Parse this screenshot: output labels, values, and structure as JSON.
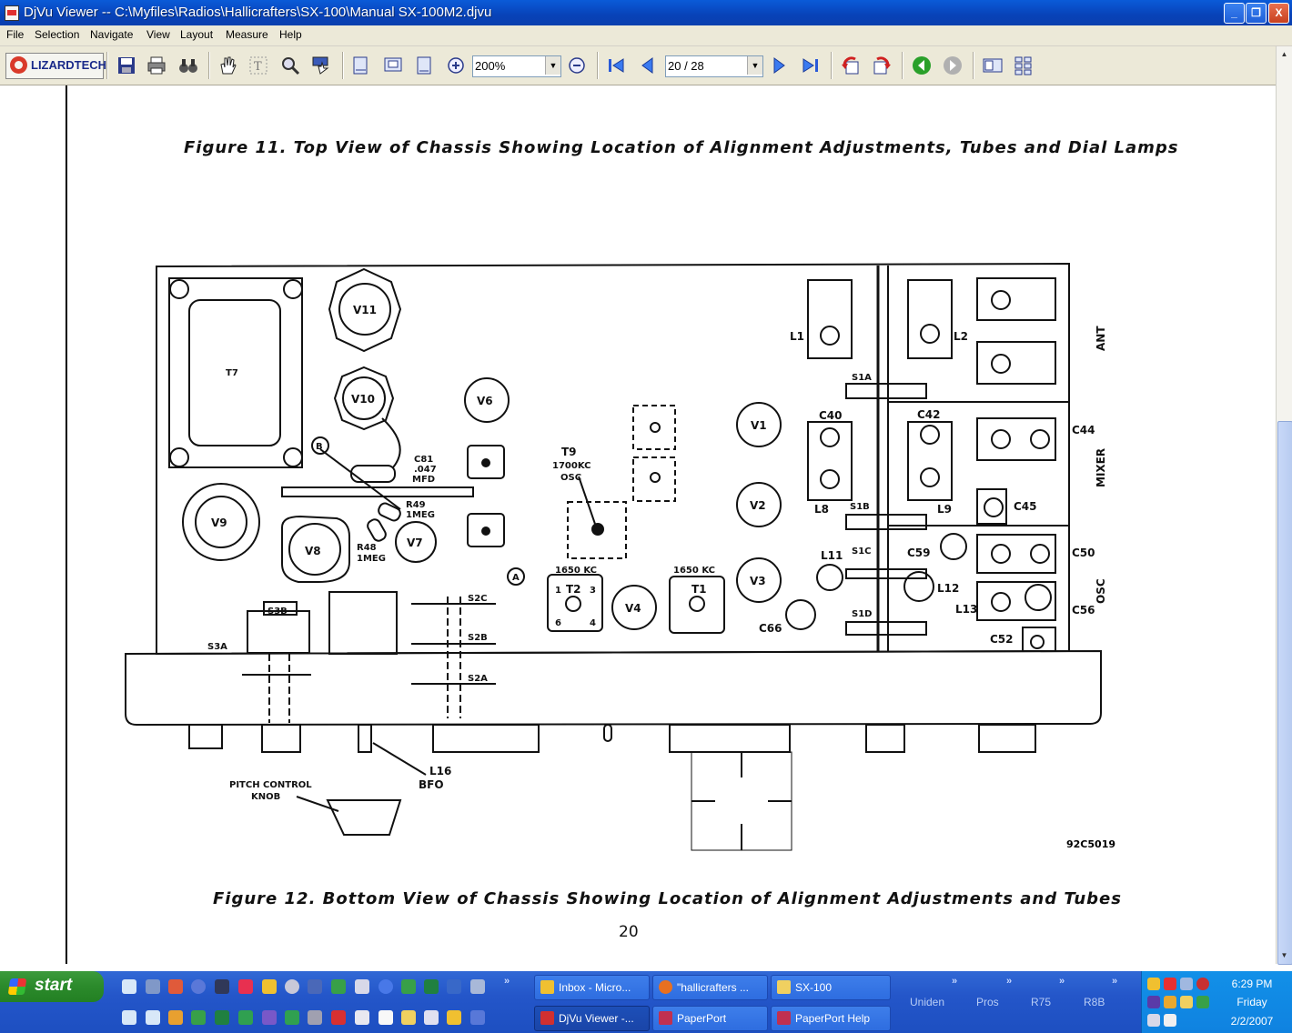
{
  "window": {
    "title": "DjVu Viewer -- C:\\Myfiles\\Radios\\Hallicrafters\\SX-100\\Manual SX-100M2.djvu",
    "minimize": "_",
    "maximize": "❐",
    "close": "X"
  },
  "menu": [
    "File",
    "Selection",
    "Navigate",
    "View",
    "Layout",
    "Measure",
    "Help"
  ],
  "toolbar": {
    "logo": "LIZARDTECH",
    "zoom": "200%",
    "page": "20 / 28"
  },
  "document": {
    "figure11_caption": "Figure 11.   Top View of Chassis Showing Location of Alignment Adjustments, Tubes and Dial Lamps",
    "figure12_caption": "Figure 12.   Bottom View of Chassis Showing Location of Alignment Adjustments and Tubes",
    "page_number": "20",
    "drawing_number": "92C5019",
    "labels": {
      "t7": "T7",
      "v11": "V11",
      "v10": "V10",
      "v6": "V6",
      "v9": "V9",
      "v8": "V8",
      "v7": "V7",
      "b": "B",
      "c81": "C81",
      "c81b": ".047",
      "c81c": "MFD",
      "r49": "R49",
      "r49b": "1MEG",
      "r48": "R48",
      "r48b": "1MEG",
      "t9": "T9",
      "t9b": "1700KC",
      "t9c": "OSC",
      "v1": "V1",
      "v2": "V2",
      "v3": "V3",
      "v4": "V4",
      "a": "A",
      "kc1650a": "1650 KC",
      "t2": "T2",
      "kc1650b": "1650 KC",
      "t1": "T1",
      "p1": "1",
      "p3": "3",
      "p6": "6",
      "p4": "4",
      "l1": "L1",
      "l2": "L2",
      "ant": "ANT",
      "s1a": "S1A",
      "c40": "C40",
      "c42": "C42",
      "c44": "C44",
      "mixer": "MIXER",
      "l8": "L8",
      "s1b": "S1B",
      "l9": "L9",
      "c45": "C45",
      "l11": "L11",
      "s1c": "S1C",
      "c59": "C59",
      "c50": "C50",
      "osc": "OSC",
      "l12": "L12",
      "l13": "L13",
      "c56": "C56",
      "s1d": "S1D",
      "c66": "C66",
      "c52": "C52",
      "s3b": "S3B",
      "s3a": "S3A",
      "s2c": "S2C",
      "s2b": "S2B",
      "s2a": "S2A",
      "l16": "L16",
      "bfo": "BFO",
      "pitch1": "PITCH CONTROL",
      "pitch2": "KNOB"
    }
  },
  "taskbar": {
    "start": "start",
    "buttons": [
      {
        "label": "Inbox - Micro...",
        "color": "#f0c030"
      },
      {
        "label": "\"hallicrafters ...",
        "color": "#e87020"
      },
      {
        "label": "SX-100",
        "color": "#f0d060"
      },
      {
        "label": "DjVu Viewer -...",
        "color": "#d03030"
      },
      {
        "label": "PaperPort",
        "color": "#c03050"
      },
      {
        "label": "PaperPort Help",
        "color": "#c03050"
      }
    ],
    "groups": [
      "Uniden",
      "Pros",
      "R75",
      "R8B"
    ],
    "clock": {
      "time": "6:29 PM",
      "day": "Friday",
      "date": "2/2/2007"
    }
  }
}
